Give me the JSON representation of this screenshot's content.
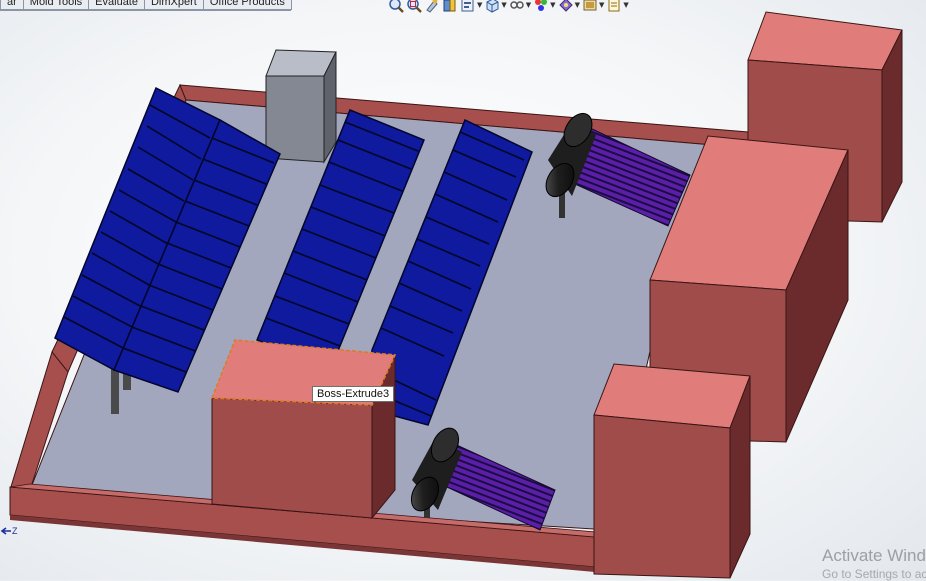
{
  "command_manager": {
    "tabs": [
      "ar",
      "Mold Tools",
      "Evaluate",
      "DimXpert",
      "Office Products"
    ]
  },
  "heads_up_toolbar": {
    "buttons": [
      {
        "icon": "zoom-to-fit-icon",
        "dropdown": false
      },
      {
        "icon": "zoom-to-area-icon",
        "dropdown": false
      },
      {
        "icon": "previous-view-icon",
        "dropdown": false
      },
      {
        "icon": "section-view-icon",
        "dropdown": false
      },
      {
        "icon": "dynamic-annotation-views-icon",
        "dropdown": true
      },
      {
        "icon": "view-orientation-icon",
        "dropdown": true
      },
      {
        "icon": "display-style-icon",
        "dropdown": true
      },
      {
        "icon": "hide-show-items-icon",
        "dropdown": true
      },
      {
        "icon": "edit-appearance-icon",
        "dropdown": true
      },
      {
        "icon": "apply-scene-icon",
        "dropdown": true
      },
      {
        "icon": "view-settings-icon",
        "dropdown": true
      }
    ]
  },
  "model_view": {
    "hover_tooltip": "Boss-Extrude3",
    "triad_axis_label": "Z",
    "colors": {
      "base_plate": "#a3a7bd",
      "wall": "#a64f4d",
      "building_top": "#e07d7a",
      "building_front": "#9f4c4b",
      "building_side": "#6b2b2d",
      "solar_panel": "#0f1a9e",
      "solar_heater": "#5a1fa6",
      "tank": "#1e1e1e",
      "cabinet": "#838893",
      "selection_highlight": "#e07a2a"
    }
  },
  "windows_watermark": {
    "title": "Activate Windows",
    "subtitle": "Go to Settings to activate Windows."
  }
}
